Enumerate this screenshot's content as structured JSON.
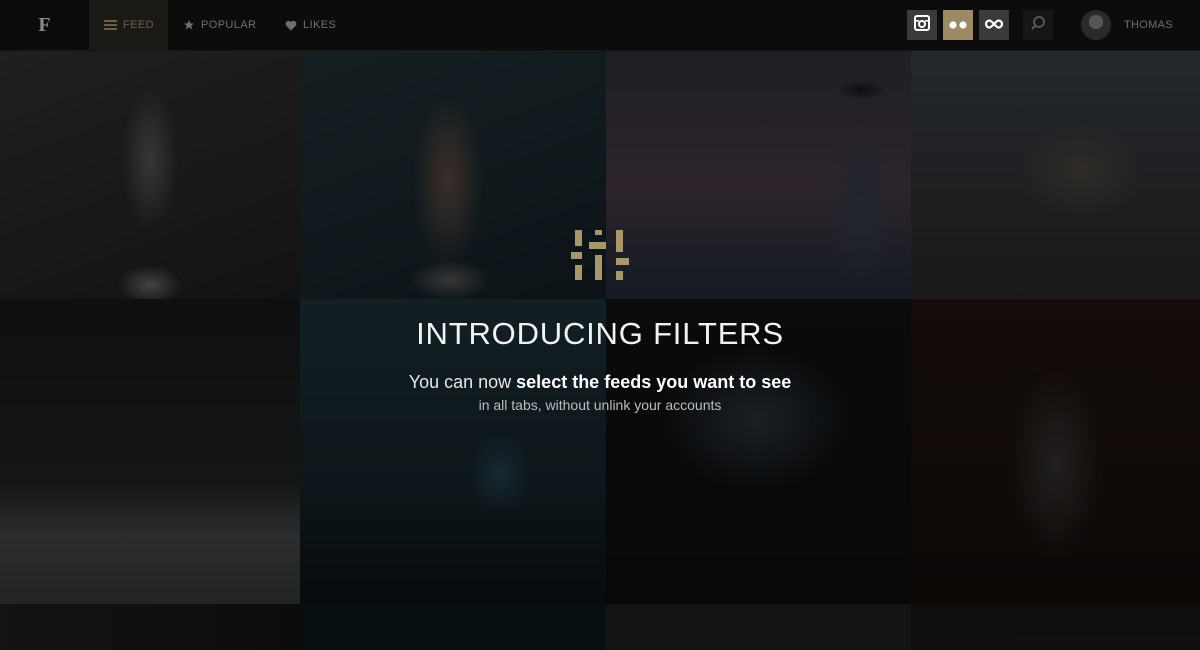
{
  "app": {
    "logo": "F"
  },
  "nav": {
    "feed_label": "FEED",
    "popular_label": "POPULAR",
    "likes_label": "LIKES"
  },
  "sources": {
    "instagram": "instagram-icon",
    "flickr": "flickr-icon",
    "fivehundred": "infinity-icon",
    "active": "flickr"
  },
  "user": {
    "name": "THOMAS"
  },
  "announcement": {
    "title": "INTRODUCING FILTERS",
    "line1_prefix": "You can now ",
    "line1_bold": "select the feeds you want to see",
    "line2": "in all tabs, without unlink your accounts"
  },
  "colors": {
    "accent": "#9b8a64",
    "topbar": "#0c0c0c",
    "icon_gold": "#a7976b"
  }
}
